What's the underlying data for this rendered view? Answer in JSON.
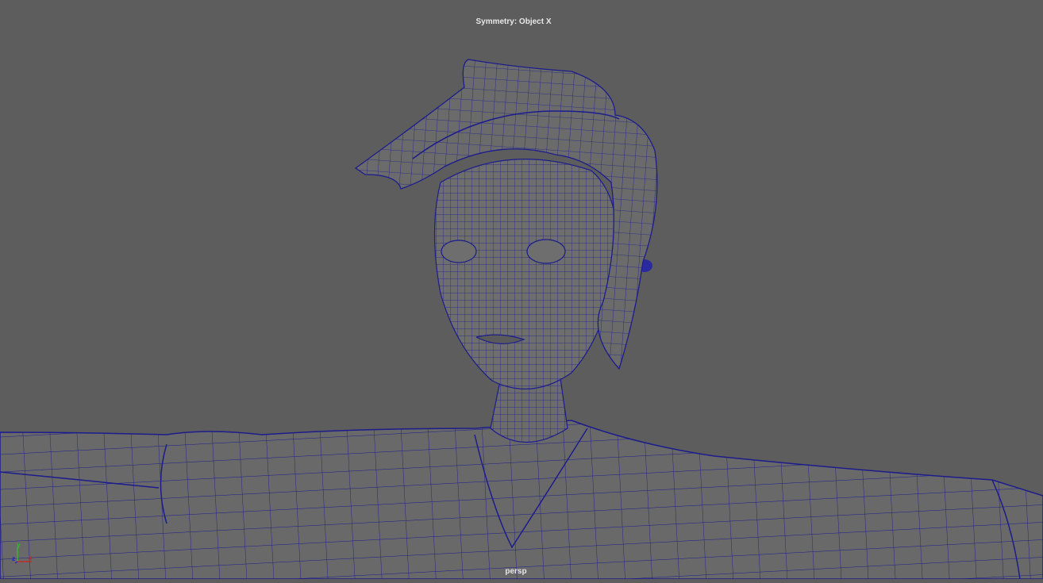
{
  "viewport": {
    "symmetry_label": "Symmetry: Object X",
    "camera_label": "persp",
    "axis": {
      "x": "x",
      "y": "y",
      "z": "z"
    },
    "colors": {
      "background": "#5d5d5d",
      "mesh": "#6a6a6a",
      "wireframe": "#1c1c8c",
      "axis_x": "#d02020",
      "axis_y": "#30c030",
      "axis_z": "#2020d0"
    }
  }
}
